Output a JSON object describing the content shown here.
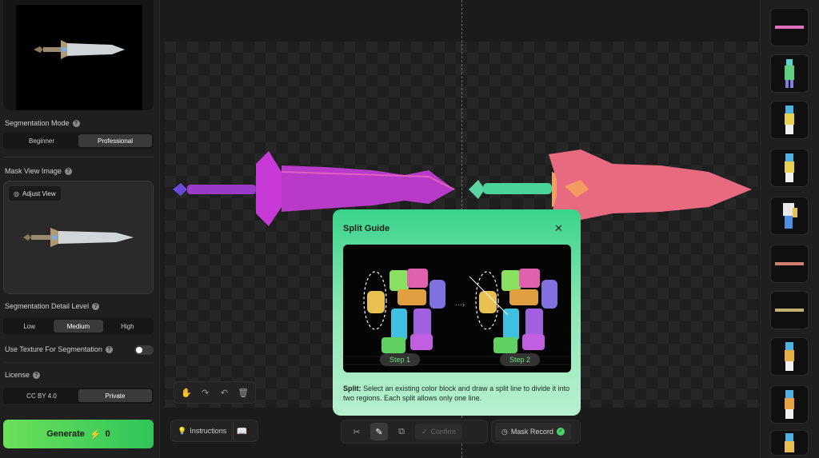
{
  "left_panel": {
    "segmentation_mode": {
      "label": "Segmentation Mode",
      "options": [
        "Beginner",
        "Professional"
      ],
      "selected": "Professional"
    },
    "mask_view": {
      "label": "Mask View Image",
      "adjust_label": "Adjust View"
    },
    "detail_level": {
      "label": "Segmentation Detail Level",
      "options": [
        "Low",
        "Medium",
        "High"
      ],
      "selected": "Medium"
    },
    "texture": {
      "label": "Use Texture For Segmentation",
      "enabled": false
    },
    "license": {
      "label": "License",
      "options": [
        "CC BY 4.0",
        "Private"
      ],
      "selected": "Private"
    },
    "generate": {
      "label": "Generate",
      "cost": "0"
    }
  },
  "toolbar": {
    "instructions_label": "Instructions",
    "confirm_label": "Confirm",
    "mask_record_label": "Mask Record"
  },
  "split_guide": {
    "title": "Split Guide",
    "step1": "Step 1",
    "step2": "Step 2",
    "desc_bold": "Split:",
    "desc": "Select an existing color block and draw a split line to divide it into two regions. Each split allows only one line."
  },
  "right_panel": {
    "thumbnails": [
      "sword-pink",
      "figure-green",
      "figure-yellow",
      "figure-yellow-2",
      "figure-white",
      "sword-brown",
      "sword-gold",
      "figure-blue-yellow",
      "figure-blue-orange",
      "figure-blue-yellow-2"
    ]
  },
  "colors": {
    "accent": "#2fc45a",
    "guide_top": "#39d38b",
    "sword_purple": "#b03ad0",
    "sword_pink": "#e86a80"
  }
}
